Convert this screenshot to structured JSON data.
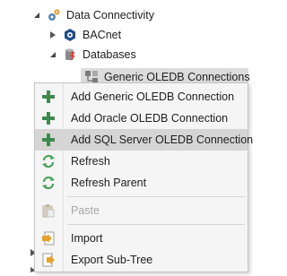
{
  "tree": {
    "data_connectivity": "Data Connectivity",
    "bacnet": "BACnet",
    "databases": "Databases",
    "generic_oledb": "Generic OLEDB Connections"
  },
  "context_menu": {
    "items": [
      {
        "label": "Add Generic OLEDB Connection",
        "icon": "plus-icon"
      },
      {
        "label": "Add Oracle OLEDB Connection",
        "icon": "plus-icon"
      },
      {
        "label": "Add SQL Server OLEDB Connection",
        "icon": "plus-icon"
      },
      {
        "label": "Refresh",
        "icon": "refresh-icon"
      },
      {
        "label": "Refresh Parent",
        "icon": "refresh-icon"
      },
      {
        "label": "Paste",
        "icon": "paste-icon",
        "disabled": true
      },
      {
        "label": "Import",
        "icon": "import-icon"
      },
      {
        "label": "Export Sub-Tree",
        "icon": "export-icon"
      }
    ]
  },
  "colors": {
    "plus": "#3f8a4f",
    "refresh": "#49a35a",
    "selection": "#dcdcdc",
    "hover": "#d5d5d5"
  }
}
